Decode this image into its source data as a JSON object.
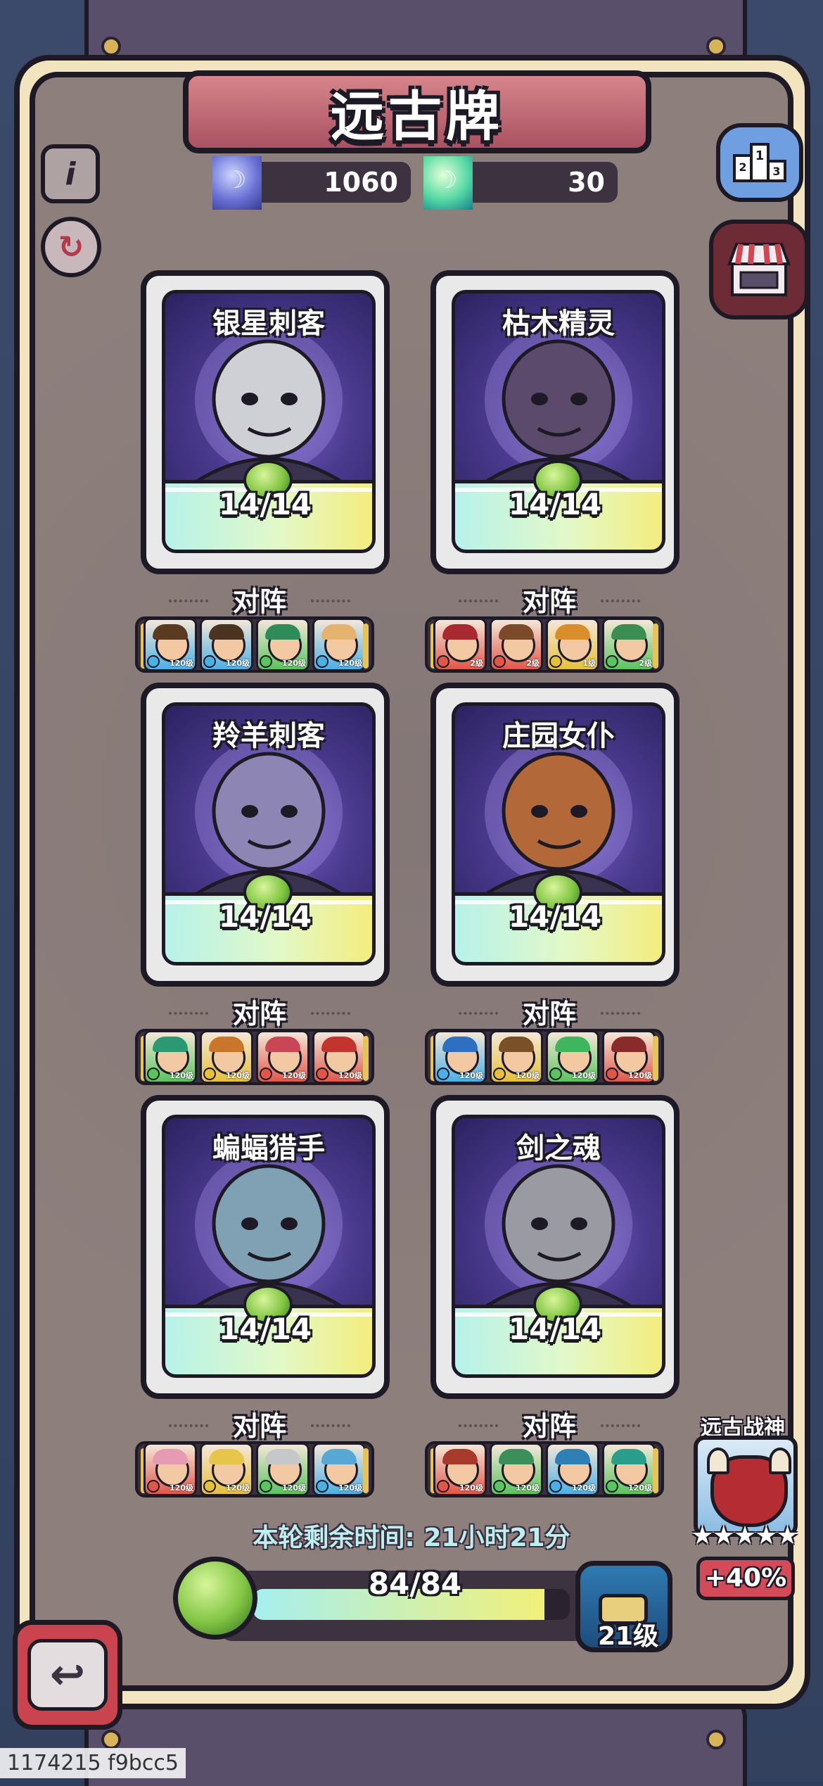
{
  "title": "远古牌",
  "currencies": [
    {
      "id": "blue-gem",
      "icon": "blue-gem-icon",
      "value": "1060"
    },
    {
      "id": "green-gem",
      "icon": "green-gem-icon",
      "value": "30"
    }
  ],
  "buttons": {
    "info": "i",
    "refresh": "↻",
    "back": "↩"
  },
  "cards": [
    {
      "name": "银星刺客",
      "count": "14/14",
      "lineup_label": "对阵",
      "art_color": "#cfcfd6",
      "heroes": [
        {
          "lvl": "120级",
          "hair": "#5a3b22",
          "elem": "#4bb0e6"
        },
        {
          "lvl": "120级",
          "hair": "#4b3321",
          "elem": "#4bb0e6"
        },
        {
          "lvl": "120级",
          "hair": "#2f8b5a",
          "elem": "#5ac45e"
        },
        {
          "lvl": "120级",
          "hair": "#e5b370",
          "elem": "#4bb0e6"
        }
      ]
    },
    {
      "name": "枯木精灵",
      "count": "14/14",
      "lineup_label": "对阵",
      "art_color": "#5b4a6b",
      "heroes": [
        {
          "lvl": "2级",
          "hair": "#a8292f",
          "elem": "#e0574a"
        },
        {
          "lvl": "2级",
          "hair": "#7a4a2a",
          "elem": "#e0574a"
        },
        {
          "lvl": "1级",
          "hair": "#d98e2b",
          "elem": "#e6c03b"
        },
        {
          "lvl": "2级",
          "hair": "#3a8e52",
          "elem": "#5ac45e"
        }
      ]
    },
    {
      "name": "羚羊刺客",
      "count": "14/14",
      "lineup_label": "对阵",
      "art_color": "#8d86b4",
      "heroes": [
        {
          "lvl": "120级",
          "hair": "#2b9a72",
          "elem": "#5ac45e"
        },
        {
          "lvl": "120级",
          "hair": "#c9762a",
          "elem": "#e6c03b"
        },
        {
          "lvl": "120级",
          "hair": "#c94656",
          "elem": "#e0574a"
        },
        {
          "lvl": "120级",
          "hair": "#c2352f",
          "elem": "#e0574a"
        }
      ]
    },
    {
      "name": "庄园女仆",
      "count": "14/14",
      "lineup_label": "对阵",
      "art_color": "#b3683a",
      "heroes": [
        {
          "lvl": "120级",
          "hair": "#2f6fbf",
          "elem": "#4bb0e6"
        },
        {
          "lvl": "120级",
          "hair": "#7a5028",
          "elem": "#e6c03b"
        },
        {
          "lvl": "120级",
          "hair": "#3fb55e",
          "elem": "#5ac45e"
        },
        {
          "lvl": "120级",
          "hair": "#8a2b2b",
          "elem": "#e0574a"
        }
      ]
    },
    {
      "name": "蝙蝠猎手",
      "count": "14/14",
      "lineup_label": "对阵",
      "art_color": "#7fa1b3",
      "heroes": [
        {
          "lvl": "120级",
          "hair": "#e79ab3",
          "elem": "#e0574a"
        },
        {
          "lvl": "120级",
          "hair": "#e7c44a",
          "elem": "#e6c03b"
        },
        {
          "lvl": "120级",
          "hair": "#c5c7c9",
          "elem": "#5ac45e"
        },
        {
          "lvl": "120级",
          "hair": "#58a8d6",
          "elem": "#4bb0e6"
        }
      ]
    },
    {
      "name": "剑之魂",
      "count": "14/14",
      "lineup_label": "对阵",
      "art_color": "#9a9aa3",
      "heroes": [
        {
          "lvl": "120级",
          "hair": "#a83a2c",
          "elem": "#e0574a"
        },
        {
          "lvl": "120级",
          "hair": "#3c8e5b",
          "elem": "#5ac45e"
        },
        {
          "lvl": "120级",
          "hair": "#2d7fb6",
          "elem": "#4bb0e6"
        },
        {
          "lvl": "120级",
          "hair": "#2a9e8a",
          "elem": "#5ac45e"
        }
      ]
    }
  ],
  "timer": {
    "label": "本轮剩余时间: ",
    "value": "21小时21分"
  },
  "progress": {
    "text": "84/84",
    "fraction": 0.92
  },
  "chest": {
    "level": "21级"
  },
  "war_god": {
    "label": "远古战神",
    "stars": "★★★★★",
    "bonus": "+40%"
  },
  "watermark": "1174215 f9bcc5"
}
